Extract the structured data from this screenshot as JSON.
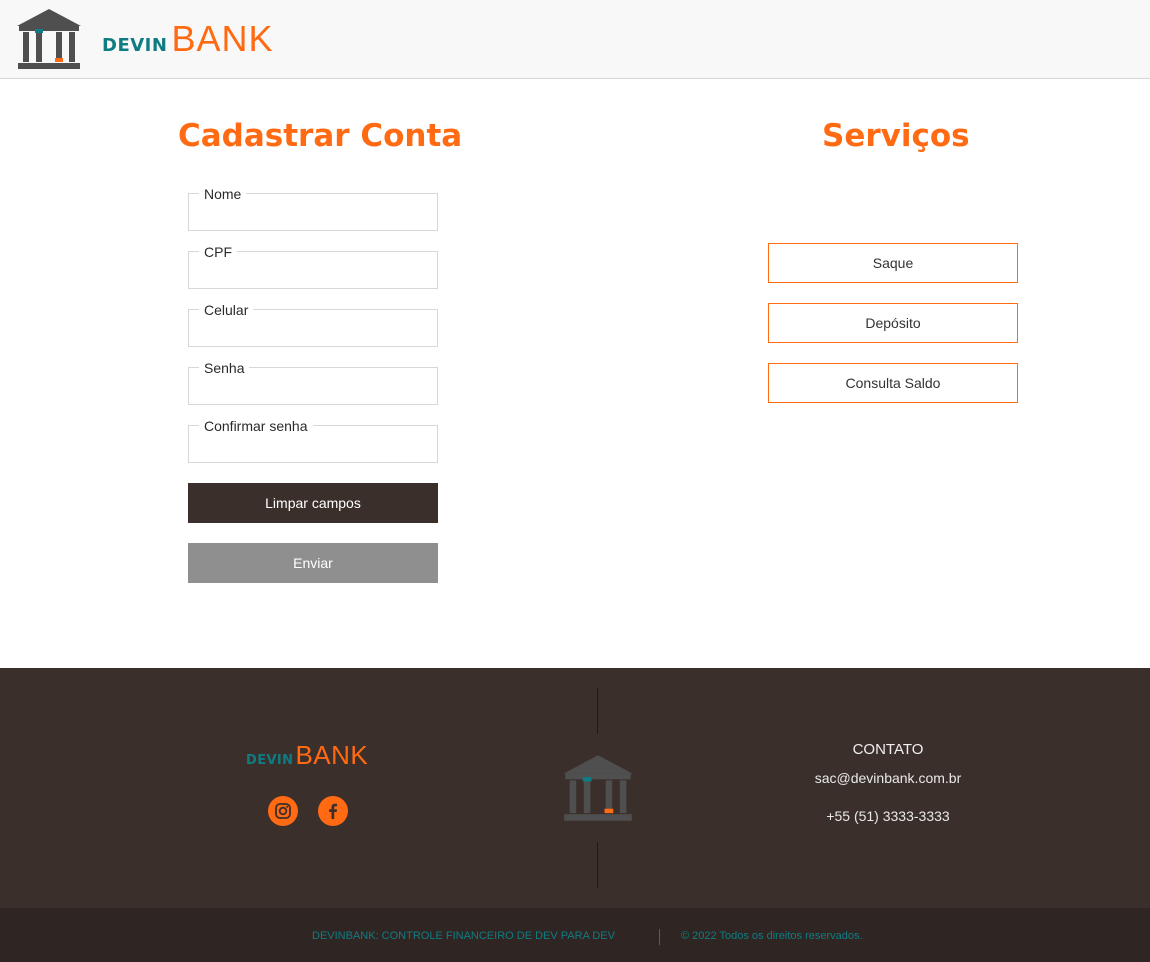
{
  "header": {
    "brand_prefix": "DEVIN",
    "brand_suffix": "BANK",
    "logo_icon": "bank-building-icon"
  },
  "register": {
    "title": "Cadastrar Conta",
    "fields": [
      {
        "label": "Nome",
        "value": ""
      },
      {
        "label": "CPF",
        "value": ""
      },
      {
        "label": "Celular",
        "value": ""
      },
      {
        "label": "Senha",
        "value": ""
      },
      {
        "label": "Confirmar senha",
        "value": ""
      }
    ],
    "clear_label": "Limpar campos",
    "submit_label": "Enviar"
  },
  "services": {
    "title": "Serviços",
    "buttons": [
      "Saque",
      "Depósito",
      "Consulta Saldo"
    ]
  },
  "footer": {
    "brand_prefix": "DEVIN",
    "brand_suffix": "BANK",
    "social_icons": [
      "instagram-icon",
      "facebook-icon"
    ],
    "contact_title": "CONTATO",
    "email": "sac@devinbank.com.br",
    "phone": "+55 (51) 3333-3333",
    "tagline": "DEVINBANK: CONTROLE FINANCEIRO DE DEV PARA DEV",
    "copyright": "© 2022 Todos os direitos reservados."
  },
  "colors": {
    "accent": "#ff6a13",
    "teal": "#0f7c83",
    "dark": "#3b2f2b"
  }
}
